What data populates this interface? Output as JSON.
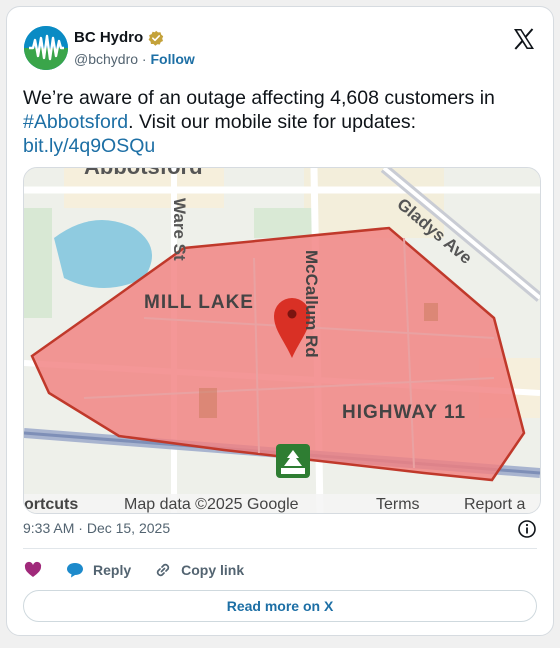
{
  "author": {
    "name": "BC Hydro",
    "handle": "@bchydro",
    "separator": "·",
    "follow_label": "Follow"
  },
  "tweet": {
    "text_before": "We’re aware of an outage affecting 4,608 customers in ",
    "hashtag": "#Abbotsford",
    "text_after": ". Visit our mobile site for updates: ",
    "link": "bit.ly/4q9OSQu"
  },
  "map": {
    "labels": {
      "top_cut": "Abbotsford",
      "ware": "Ware St",
      "gladys": "Gladys Ave",
      "mill_lake": "MILL LAKE",
      "mccallum": "McCallum Rd",
      "highway": "HIGHWAY 11"
    },
    "footer": {
      "shortcuts": "ortcuts",
      "map_data": "Map data ©2025 Google",
      "terms": "Terms",
      "report": "Report a"
    },
    "colors": {
      "outage_fill": "#f28080",
      "outage_stroke": "#c0392b",
      "pin": "#d93025"
    }
  },
  "meta": {
    "time": "9:33 AM",
    "separator": "·",
    "date": "Dec 15, 2025"
  },
  "actions": {
    "reply_label": "Reply",
    "copy_label": "Copy link"
  },
  "read_more_label": "Read more on X"
}
